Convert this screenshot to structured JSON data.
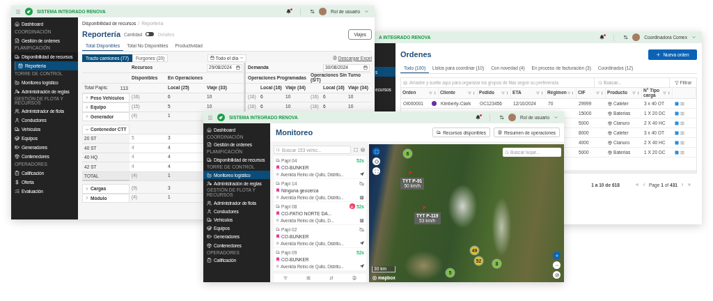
{
  "orders_window": {
    "header": {
      "app_title": "A INTEGRADO RENOVA",
      "has_notifications": true,
      "user": "Coordinadora Comex"
    },
    "sidebar": [
      {
        "label": "s",
        "selected": true
      },
      {
        "label": "ecursos",
        "selected": false
      }
    ],
    "title": "Ordenes",
    "new_button": "Nueva orden",
    "tabs": [
      {
        "label": "Todo (100)",
        "selected": true
      },
      {
        "label": "Listos para coordinar (10)",
        "selected": false
      },
      {
        "label": "Con novedad (4)",
        "selected": false
      },
      {
        "label": "En proceso de facturación (3)",
        "selected": false
      },
      {
        "label": "Coordinados (12)",
        "selected": false
      }
    ],
    "group_hint": "Arrastre y suelte aquí para organizar los grupos de filas según su preferencia.",
    "search_placeholder": "Buscar...",
    "filter_button": "Filtrar",
    "columns": [
      "Orden",
      "Cliente",
      "Pedido",
      "ETA",
      "Régimen",
      "CIF",
      "Producto",
      "N° Tipo carga"
    ],
    "rows": [
      {
        "order": "OI000001",
        "client": "Kimberly-Clark",
        "request": "OC123456",
        "eta": "12/10/2024",
        "regime": "70",
        "cif": "29999",
        "product": "Cateter",
        "load": "3 x 40 OT"
      },
      {
        "cif": "15000",
        "product": "Baterias",
        "load": "1 X 20 DC"
      },
      {
        "cif": "5000",
        "product": "Cianuro",
        "load": "2 X 40 HC"
      },
      {
        "cif": "8000",
        "product": "Cateter",
        "load": "3 x 40 OT"
      },
      {
        "cif": "4000",
        "product": "Cianuro",
        "load": "2 X 40 HC"
      },
      {
        "cif": "5000",
        "product": "Baterias",
        "load": "1 X 20 DC"
      }
    ],
    "pagination": {
      "range": "1 a 10 de 618",
      "page": "Page **1** of **431**"
    }
  },
  "report_window": {
    "header": {
      "app_title": "SISTEMA INTEGRADO RENOVA",
      "has_notifications": true,
      "user": "Rol de usuario"
    },
    "sidebar": [
      {
        "items": [
          {
            "label": "Dashboard",
            "selected": false
          }
        ]
      },
      {
        "heading": "COORDINACIÓN",
        "items": [
          {
            "label": "Gestión de ordenes",
            "selected": false
          }
        ]
      },
      {
        "heading": "PLANIFICACIÓN",
        "items": [
          {
            "label": "Disponibilidad de recursos",
            "selected": false,
            "children": [
              {
                "label": "Reportería",
                "selected": true
              }
            ]
          }
        ]
      },
      {
        "heading": "TORRE DE CONTROL",
        "items": [
          {
            "label": "Monitoreo logístico",
            "selected": false
          },
          {
            "label": "Administración de reglas",
            "selected": false
          }
        ]
      },
      {
        "heading": "GESTIÓN DE FLOTA Y RECURSOS",
        "items": [
          {
            "label": "Administrador de flota",
            "selected": false
          },
          {
            "label": "Conductores",
            "selected": false
          },
          {
            "label": "Vehículos",
            "selected": false
          },
          {
            "label": "Equipos",
            "selected": false
          },
          {
            "label": "Generadores",
            "selected": false
          },
          {
            "label": "Contenedores",
            "selected": false
          }
        ]
      },
      {
        "heading": "OPERADORES",
        "items": [
          {
            "label": "Calificación",
            "selected": false
          },
          {
            "label": "Oferta",
            "selected": false
          },
          {
            "label": "Evaluación",
            "selected": false
          }
        ]
      }
    ],
    "breadcrumb": [
      "Disponibilidad de recursos",
      "Reportería"
    ],
    "breadcrumb_separator": "/",
    "title": "Reportería",
    "view_toggle": {
      "left_label": "Cantidad",
      "right_label": "Detalles",
      "on": false
    },
    "trips_button": "Viajes",
    "tabs": [
      {
        "label": "Total Disponibles",
        "selected": true
      },
      {
        "label": "Total No Disponibles",
        "selected": false
      },
      {
        "label": "Productividad",
        "selected": false
      }
    ],
    "segments": [
      {
        "label": "Tracto camiones (77)",
        "selected": true
      },
      {
        "label": "Furgones (20)",
        "selected": false
      }
    ],
    "period": "Todo el día",
    "export_link": "Descargar Excel",
    "resources": {
      "title": "Recursos",
      "date": "29/08/2024",
      "available": "Disponibles",
      "in_operation": "En Operaciones",
      "local": "Local (25)",
      "trip": "Viaje (33)"
    },
    "demand": {
      "title": "Demanda",
      "date": "30/08/2024",
      "scheduled": "Operaciones Programadas",
      "unscheduled": "Operaciones Sin Turno (S/T)",
      "scheduled_local": "Local (16)",
      "scheduled_trip": "Viaje (34)",
      "unscheduled_local": "Local (16)",
      "unscheduled_trip": "Viaje (34)"
    },
    "total_label": "Total Papis:",
    "total_value": "113",
    "groups": [
      {
        "label": "Peso Vehiculos",
        "expanded": false,
        "values": [
          "(16)",
          "6",
          "10",
          "(16)",
          "6",
          "10",
          "(16)",
          "6",
          "10"
        ]
      },
      {
        "label": "Equipo",
        "expanded": false,
        "values": [
          "(15)",
          "5",
          "10",
          "(16)",
          "6",
          "10",
          "(16)",
          "6",
          "10"
        ]
      },
      {
        "label": "Generador",
        "expanded": false,
        "values": [
          "(4)",
          "1"
        ]
      },
      {
        "label": "Contenedor CTT",
        "expanded": true,
        "children": [
          {
            "label": "20 ST",
            "kind": "item",
            "values": [
              "5",
              "3"
            ]
          },
          {
            "label": "40 ST",
            "kind": "item",
            "values": [
              "4",
              "4"
            ]
          },
          {
            "label": "40 HQ",
            "kind": "item",
            "values": [
              "4",
              "4"
            ]
          },
          {
            "label": "42 ST",
            "kind": "item",
            "values": [
              "4",
              "4"
            ]
          },
          {
            "label": "TOTAL",
            "kind": "total",
            "values": [
              "(4)",
              "1"
            ]
          }
        ]
      },
      {
        "label": "Cargas",
        "expanded": false,
        "values": [
          "(9)",
          "3"
        ]
      },
      {
        "label": "Módulo",
        "expanded": false,
        "values": [
          "(4)",
          "1"
        ]
      }
    ]
  },
  "monitor_window": {
    "header": {
      "app_title": "SISTEMA INTEGRADO RENOVA",
      "has_notifications": true,
      "user": "Rol de usuario"
    },
    "sidebar": [
      {
        "items": [
          {
            "label": "Dashboard",
            "selected": false
          }
        ]
      },
      {
        "heading": "COORDINACIÓN",
        "items": [
          {
            "label": "Gestión de ordenes",
            "selected": false
          }
        ]
      },
      {
        "heading": "PLANIFICACIÓN",
        "items": [
          {
            "label": "Disponibilidad de recursos",
            "selected": false
          }
        ]
      },
      {
        "heading": "TORRE DE CONTROL",
        "items": [
          {
            "label": "Monitoreo logístico",
            "selected": true
          },
          {
            "label": "Administración de reglas",
            "selected": false
          }
        ]
      },
      {
        "heading": "GESTIÓN DE FLOTA Y RECURSOS",
        "items": [
          {
            "label": "Administrador de flota",
            "selected": false
          },
          {
            "label": "Conductores",
            "selected": false
          },
          {
            "label": "Vehículos",
            "selected": false
          },
          {
            "label": "Equipos",
            "selected": false
          },
          {
            "label": "Generadores",
            "selected": false
          },
          {
            "label": "Contenedores",
            "selected": false
          }
        ]
      },
      {
        "heading": "OPERADORES",
        "items": [
          {
            "label": "Calificación",
            "selected": false
          }
        ]
      }
    ],
    "title": "Monitoreo",
    "actions": [
      "Recursos disponibles",
      "Resumen de operaciones"
    ],
    "search_placeholder": "Buscar 153 vehíc...",
    "vehicles": [
      {
        "name": "Papi 04",
        "geofence": "CO-BUNKER",
        "address": "Avenida Reino de Quito, Distrito...",
        "online": true,
        "time": "52s",
        "alert": false,
        "moving": true
      },
      {
        "name": "Papi 14",
        "geofence": "Ninguna geocerca",
        "address": "Avenida Reino de Quito, Distrito...",
        "online": false,
        "alert": false,
        "moving": false
      },
      {
        "name": "Papi 08",
        "geofence": "CO-PATIO NORTE DA...",
        "address": "Avenida Reino de Quito, D...",
        "online": true,
        "time": "52s",
        "alert": true,
        "moving": false
      },
      {
        "name": "Papi 02",
        "geofence": "CO-BUNKER",
        "address": "Avenida Reino de Quito, Distrito...",
        "online": false,
        "alert": false,
        "moving": true
      },
      {
        "name": "Papi 09",
        "geofence": "CO-BUNKER",
        "address": "Avenida Reino de Quito, Distrito...",
        "online": true,
        "time": "52s",
        "alert": false,
        "moving": true
      }
    ],
    "map": {
      "search_placeholder": "Buscar lugar...",
      "clusters": [
        {
          "count": "6",
          "color": "#7cc242"
        },
        {
          "count": "49",
          "color": "#e2bf2a"
        },
        {
          "count": "52",
          "color": "#e2bf2a"
        },
        {
          "count": "8",
          "color": "#7cc242"
        },
        {
          "count": "5",
          "color": "#7cc242"
        }
      ],
      "vehicles": [
        {
          "name": "TYT P-91",
          "speed": "50 km/h"
        },
        {
          "name": "TYT P-119",
          "speed": "53 km/h"
        }
      ],
      "scale": "30 km",
      "attribution": "mapbox"
    }
  }
}
